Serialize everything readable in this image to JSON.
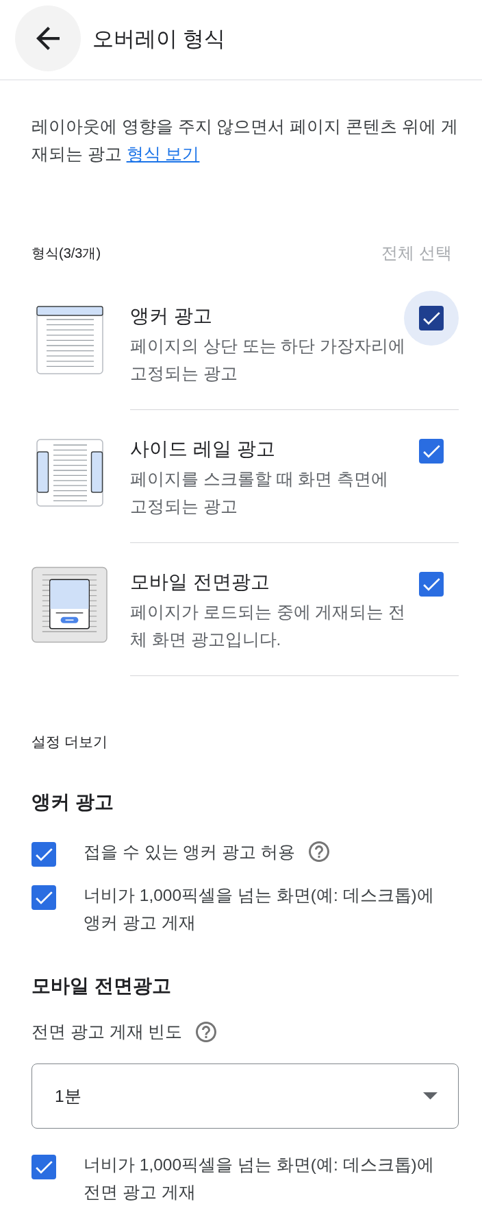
{
  "header": {
    "title": "오버레이 형식"
  },
  "intro": {
    "text": "레이아웃에 영향을 주지 않으면서 페이지 콘텐츠 위에 게재되는 광고",
    "link": "형식 보기"
  },
  "formats": {
    "count_label": "형식(3/3개)",
    "select_all": {
      "label": "전체 선택",
      "disabled": true
    },
    "items": [
      {
        "kind": "anchor",
        "title": "앵커 광고",
        "description": "페이지의 상단 또는 하단 가장자리에 고정되는 광고",
        "checked": true,
        "focused": true
      },
      {
        "kind": "side_rail",
        "title": "사이드 레일 광고",
        "description": "페이지를 스크롤할 때 화면 측면에 고정되는 광고",
        "checked": true,
        "focused": false
      },
      {
        "kind": "vignette",
        "title": "모바일 전면광고",
        "description": "페이지가 로드되는 중에 게재되는 전체 화면 광고입니다.",
        "checked": true,
        "focused": false
      }
    ]
  },
  "more_settings": {
    "label": "설정 더보기",
    "anchor": {
      "title": "앵커 광고",
      "options": [
        {
          "label": "접을 수 있는 앵커 광고 허용",
          "checked": true,
          "help": true
        },
        {
          "label": "너비가 1,000픽셀을 넘는 화면(예: 데스크톱)에 앵커 광고 게재",
          "checked": true,
          "help": false
        }
      ]
    },
    "vignette": {
      "title": "모바일 전면광고",
      "frequency": {
        "label": "전면 광고 게재 빈도",
        "help": true,
        "value": "1분"
      },
      "options": [
        {
          "label": "너비가 1,000픽셀을 넘는 화면(예: 데스크톱)에 전면 광고 게재",
          "checked": true,
          "help": false
        }
      ]
    }
  }
}
